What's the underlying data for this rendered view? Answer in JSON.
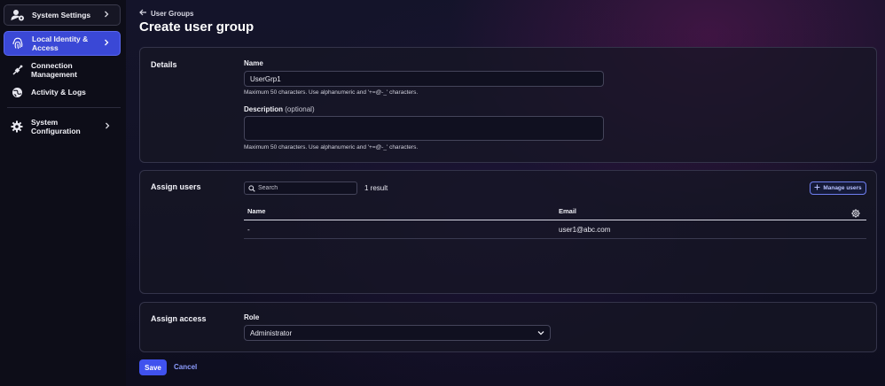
{
  "sidebar": {
    "items": [
      {
        "label": "System Settings",
        "icon": "user-gear-icon"
      },
      {
        "label": "Local Identity & Access",
        "icon": "fingerprint-icon"
      },
      {
        "label": "Connection Management",
        "icon": "plug-icon"
      },
      {
        "label": "Activity & Logs",
        "icon": "globe-icon"
      },
      {
        "label": "System Configuration",
        "icon": "gear-icon"
      }
    ]
  },
  "header": {
    "back_label": "User Groups",
    "title": "Create user group"
  },
  "details": {
    "heading": "Details",
    "name_label": "Name",
    "name_value": "UserGrp1",
    "name_hint": "Maximum 50 characters. Use alphanumeric and '+=@-_' characters.",
    "description_label": "Description",
    "description_optional": "(optional)",
    "description_value": "",
    "description_hint": "Maximum 50 characters. Use alphanumeric and '+=@-_' characters."
  },
  "assign_users": {
    "heading": "Assign users",
    "search_placeholder": "Search",
    "result_count": "1 result",
    "manage_label": "Manage users",
    "columns": [
      "Name",
      "Email"
    ],
    "rows": [
      {
        "name": "-",
        "email": "user1@abc.com"
      }
    ]
  },
  "assign_access": {
    "heading": "Assign access",
    "role_label": "Role",
    "role_value": "Administrator"
  },
  "footer": {
    "save_label": "Save",
    "cancel_label": "Cancel"
  },
  "colors": {
    "accent": "#4052ee",
    "active_nav": "#3a48d6",
    "link": "#8c9cff"
  }
}
